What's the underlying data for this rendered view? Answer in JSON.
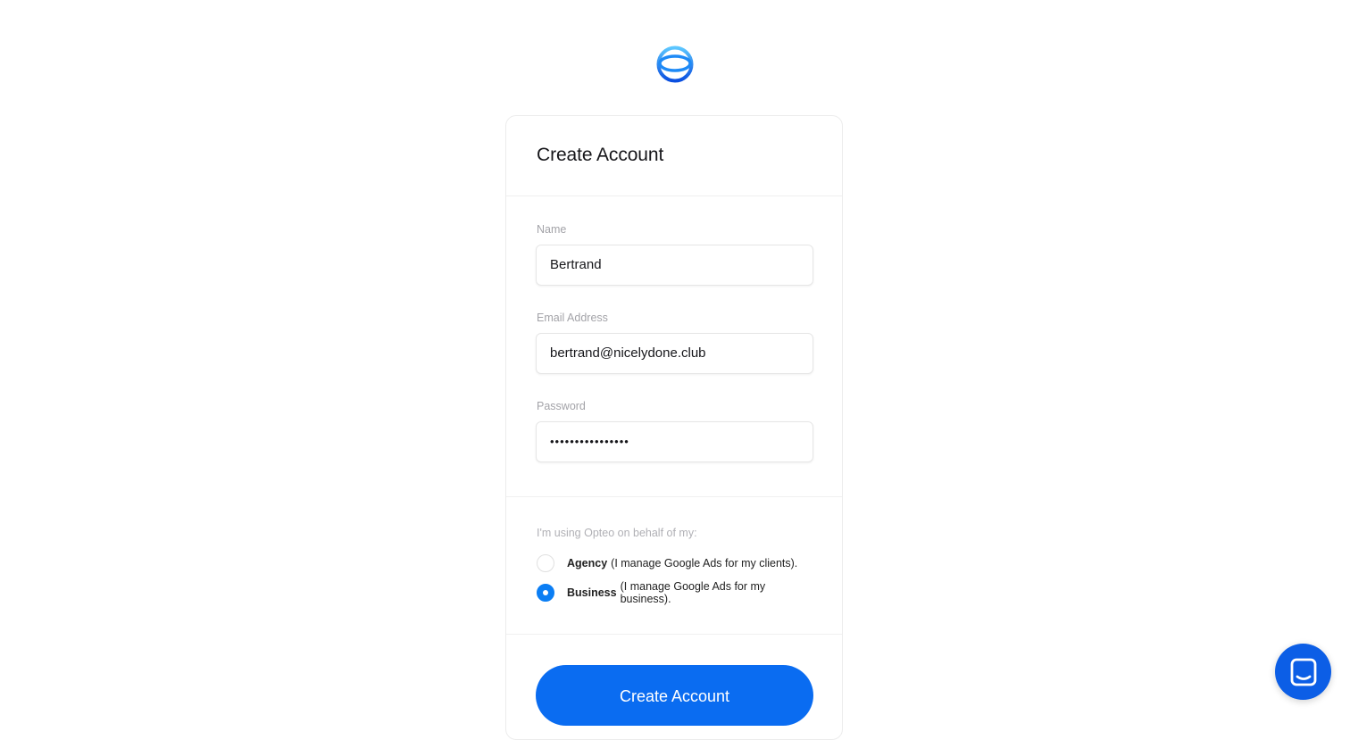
{
  "brand": {
    "logo": "opteo-logo-icon"
  },
  "card": {
    "title": "Create Account",
    "fields": {
      "name_label": "Name",
      "name_value": "Bertrand",
      "email_label": "Email Address",
      "email_value": "bertrand@nicelydone.club",
      "password_label": "Password",
      "password_value": "••••••••••••••••"
    },
    "usage": {
      "label": "I'm using Opteo on behalf of my:",
      "options": [
        {
          "title": "Agency",
          "desc": "(I manage Google Ads for my clients).",
          "selected": false
        },
        {
          "title": "Business",
          "desc": "(I manage Google Ads for my business).",
          "selected": true
        }
      ]
    },
    "submit_label": "Create Account"
  },
  "chat": {
    "icon": "chat-bubble-icon"
  },
  "colors": {
    "accent": "#0a6cf1",
    "radio_selected": "#0b7ef4",
    "chat": "#0c5ee6"
  }
}
